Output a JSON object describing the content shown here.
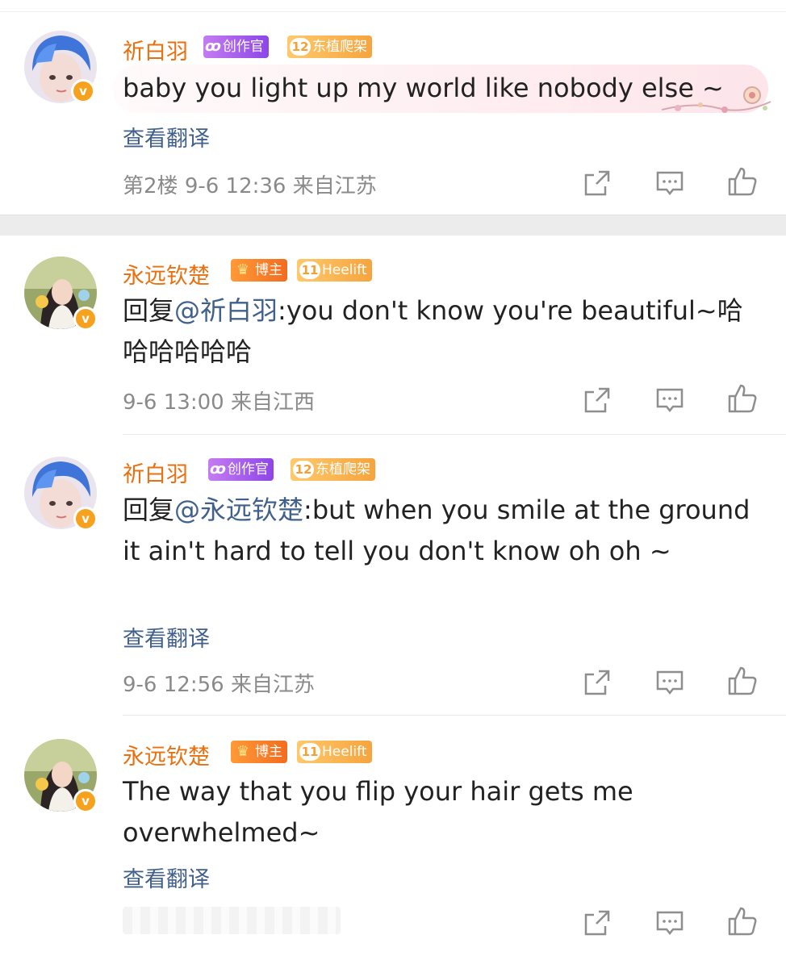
{
  "comments": [
    {
      "username": "祈白羽",
      "badges": {
        "role": "创作官",
        "level": "12",
        "fan": "东植爬架"
      },
      "text": "baby you light up my world like nobody else ~",
      "translate": "查看翻译",
      "floor": "第2楼",
      "time": "9-6 12:36",
      "location": "来自江苏"
    },
    {
      "username": "永远钦楚",
      "badges": {
        "role": "博主",
        "level": "11",
        "fan": "Heelift"
      },
      "reply_prefix": "回复",
      "mention": "@祈白羽",
      "text": ":you don't know you're beautiful~哈哈哈哈哈哈",
      "time": "9-6 13:00",
      "location": "来自江西"
    },
    {
      "username": "祈白羽",
      "badges": {
        "role": "创作官",
        "level": "12",
        "fan": "东植爬架"
      },
      "reply_prefix": "回复",
      "mention": "@永远钦楚",
      "text": ":but when you smile at the ground it ain't hard to tell you don't know oh oh ~",
      "translate": "查看翻译",
      "time": "9-6 12:56",
      "location": "来自江苏"
    },
    {
      "username": "永远钦楚",
      "badges": {
        "role": "博主",
        "level": "11",
        "fan": "Heelift"
      },
      "text": "The way that you flip your hair gets me overwhelmed~",
      "translate": "查看翻译"
    }
  ],
  "verified_badge": "v",
  "badge_icons": {
    "creator": "weibo-creator-icon",
    "host": "crown-icon"
  },
  "actions": [
    "share-icon",
    "comment-icon",
    "like-icon"
  ],
  "colors": {
    "username": "#e8700f",
    "mention": "#41608c",
    "meta": "#8a8a8a"
  }
}
